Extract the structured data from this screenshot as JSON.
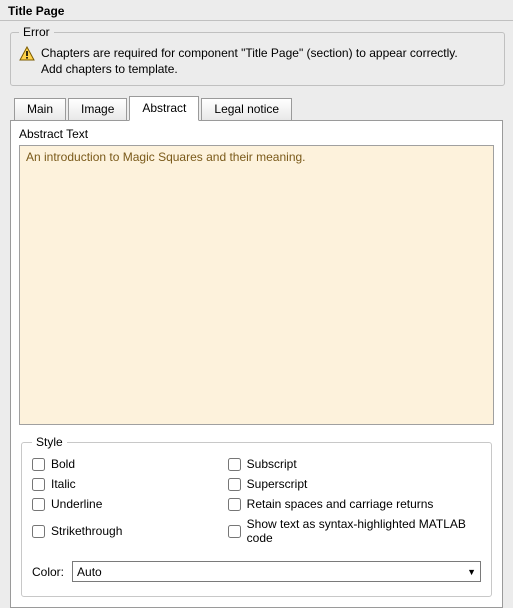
{
  "title": "Title Page",
  "error": {
    "legend": "Error",
    "line1": "Chapters are required for component \"Title Page\" (section) to appear correctly.",
    "line2": "Add chapters to template."
  },
  "tabs": {
    "main": "Main",
    "image": "Image",
    "abstract": "Abstract",
    "legal": "Legal notice"
  },
  "abstract": {
    "label": "Abstract Text",
    "value": "An introduction to Magic Squares and their meaning."
  },
  "style": {
    "legend": "Style",
    "bold": "Bold",
    "italic": "Italic",
    "underline": "Underline",
    "strikethrough": "Strikethrough",
    "subscript": "Subscript",
    "superscript": "Superscript",
    "retain": "Retain spaces and carriage returns",
    "matlab": "Show text as syntax-highlighted MATLAB code",
    "color_label": "Color:",
    "color_value": "Auto"
  }
}
